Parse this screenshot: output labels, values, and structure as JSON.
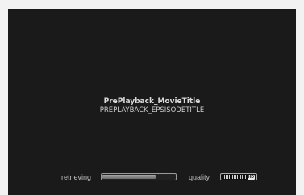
{
  "player": {
    "movie_title": "PrePlayback_MovieTitle",
    "episode_title": "PREPLAYBACK_EPSISODETITLE"
  },
  "status": {
    "retrieving_label": "retrieving",
    "retrieving_progress": 0.72,
    "quality_label": "quality",
    "quality_badge": "HD"
  }
}
